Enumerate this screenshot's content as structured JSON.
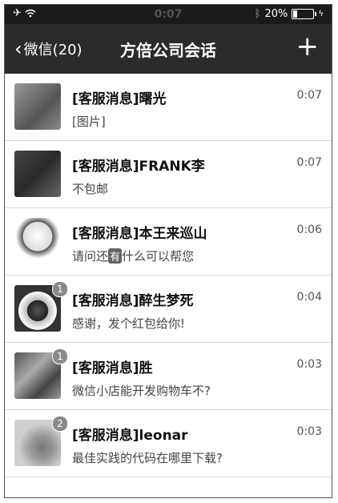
{
  "status_bar": {
    "time": "0:07",
    "battery": "20%",
    "battery_level": 0.2
  },
  "nav": {
    "back_label": "微信(20)",
    "title": "方倍公司会话",
    "add_label": "+"
  },
  "conversations": [
    {
      "name": "[客服消息]曙光",
      "message": "[图片]",
      "time": "0:07",
      "badge": ""
    },
    {
      "name": "[客服消息]FRANK李",
      "message": "不包邮",
      "time": "0:07",
      "badge": ""
    },
    {
      "name": "[客服消息]本王来巡山",
      "message_pre": "请问还",
      "message_emoji": "有",
      "message_post": "什么可以帮您",
      "time": "0:06",
      "badge": ""
    },
    {
      "name": "[客服消息]醉生梦死",
      "message": "感谢，发个红包给你!",
      "time": "0:04",
      "badge": "1"
    },
    {
      "name": "[客服消息]胜",
      "message": "微信小店能开发购物车不?",
      "time": "0:03",
      "badge": "1"
    },
    {
      "name": "[客服消息]leonar",
      "message": "最佳实践的代码在哪里下载?",
      "time": "0:03",
      "badge": "2"
    }
  ]
}
